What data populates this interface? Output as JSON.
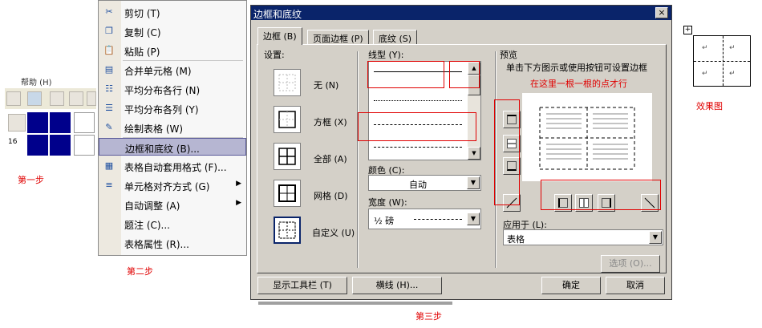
{
  "step1": {
    "partial_label": "帮助 (H)",
    "cell_label": "16",
    "caption": "第一步"
  },
  "step2": {
    "caption": "第二步",
    "menu": [
      {
        "label": "剪切 (T)",
        "icon": "scissors-icon",
        "glyph": "✂"
      },
      {
        "label": "复制 (C)",
        "icon": "copy-icon",
        "glyph": "❐"
      },
      {
        "label": "粘贴 (P)",
        "icon": "paste-icon",
        "glyph": "📋"
      },
      {
        "label": "合并单元格 (M)",
        "icon": "merge-cells-icon",
        "glyph": "▤"
      },
      {
        "label": "平均分布各行 (N)",
        "icon": "distribute-rows-icon",
        "glyph": "☷"
      },
      {
        "label": "平均分布各列 (Y)",
        "icon": "distribute-columns-icon",
        "glyph": "☰"
      },
      {
        "label": "绘制表格 (W)",
        "icon": "draw-table-icon",
        "glyph": "✎"
      },
      {
        "label": "边框和底纹 (B)...",
        "icon": "",
        "glyph": "",
        "highlighted": true
      },
      {
        "label": "表格自动套用格式 (F)...",
        "icon": "table-autoformat-icon",
        "glyph": "▦"
      },
      {
        "label": "单元格对齐方式 (G)",
        "icon": "cell-align-icon",
        "glyph": "≡",
        "submenu": true
      },
      {
        "label": "自动调整 (A)",
        "icon": "",
        "glyph": "",
        "submenu": true
      },
      {
        "label": "题注 (C)...",
        "icon": "",
        "glyph": ""
      },
      {
        "label": "表格属性 (R)...",
        "icon": "",
        "glyph": ""
      }
    ]
  },
  "dialog": {
    "title": "边框和底纹",
    "close": "×",
    "tabs": [
      "边框 (B)",
      "页面边框 (P)",
      "底纹 (S)"
    ],
    "settings_label": "设置:",
    "settings": [
      "无 (N)",
      "方框 (X)",
      "全部 (A)",
      "网格 (D)",
      "自定义 (U)"
    ],
    "line_style_label": "线型 (Y):",
    "color_label": "颜色 (C):",
    "color_value": "自动",
    "width_label": "宽度 (W):",
    "width_value": "½ 磅",
    "preview_label": "预览",
    "preview_hint": "单击下方图示或使用按钮可设置边框",
    "preview_annotation": "在这里一根一根的点才行",
    "apply_label": "应用于 (L):",
    "apply_value": "表格",
    "options_button": "选项 (O)...",
    "show_toolbar_button": "显示工具栏 (T)",
    "hline_button": "横线 (H)...",
    "ok_button": "确定",
    "cancel_button": "取消"
  },
  "step3_caption": "第三步",
  "result": {
    "caption": "效果图",
    "cell_mark": "↵"
  },
  "colors": {
    "annotation_red": "#e00000",
    "title_bar": "#0a246a",
    "dialog_face": "#d4d0c8",
    "navy_cells": "#00008b",
    "menu_highlight": "#b6b6d2"
  }
}
